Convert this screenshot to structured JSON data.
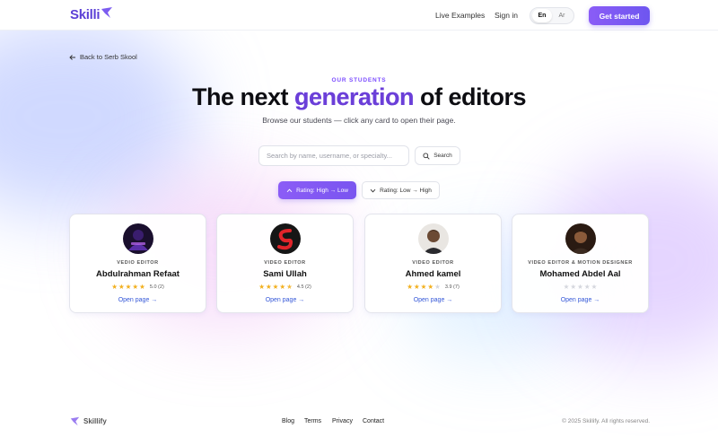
{
  "header": {
    "logo_text": "Skilli",
    "nav": {
      "live_examples": "Live Examples",
      "sign_in": "Sign in"
    },
    "lang": {
      "en": "En",
      "ar": "Ar",
      "active": "En"
    },
    "cta": "Get started"
  },
  "back_link": "Back to Serb Skool",
  "hero": {
    "eyebrow": "OUR STUDENTS",
    "title_before": "The next ",
    "title_accent": "generation",
    "title_after": " of editors",
    "subtitle": "Browse our students — click any card to open their page."
  },
  "search": {
    "placeholder": "Search by name, username, or specialty...",
    "value": "",
    "button_label": "Search"
  },
  "sort": {
    "high_low": "Rating: High → Low",
    "low_high": "Rating: Low → High",
    "active": "high_low"
  },
  "students": [
    {
      "role": "VEDIO EDITOR",
      "name": "Abdulrahman Refaat",
      "rating": 5.0,
      "rating_text": "5.0 (2)",
      "link": "Open page →"
    },
    {
      "role": "VIDEO EDITOR",
      "name": "Sami Ullah",
      "rating": 4.5,
      "rating_text": "4.5 (2)",
      "link": "Open page →"
    },
    {
      "role": "VIDEO EDITOR",
      "name": "Ahmed kamel",
      "rating": 3.9,
      "rating_text": "3.9 (7)",
      "link": "Open page →"
    },
    {
      "role": "VIDEO EDITOR & MOTION DESIGNER",
      "name": "Mohamed Abdel Aal",
      "rating": 0,
      "rating_text": "",
      "link": "Open page →"
    }
  ],
  "footer": {
    "logo_text": "Skillify",
    "links": {
      "blog": "Blog",
      "terms": "Terms",
      "privacy": "Privacy",
      "contact": "Contact"
    },
    "copyright": "© 2025 Skillify. All rights reserved."
  },
  "colors": {
    "brand": "#7c4dff",
    "star": "#f2b01e",
    "link": "#3558d8"
  }
}
